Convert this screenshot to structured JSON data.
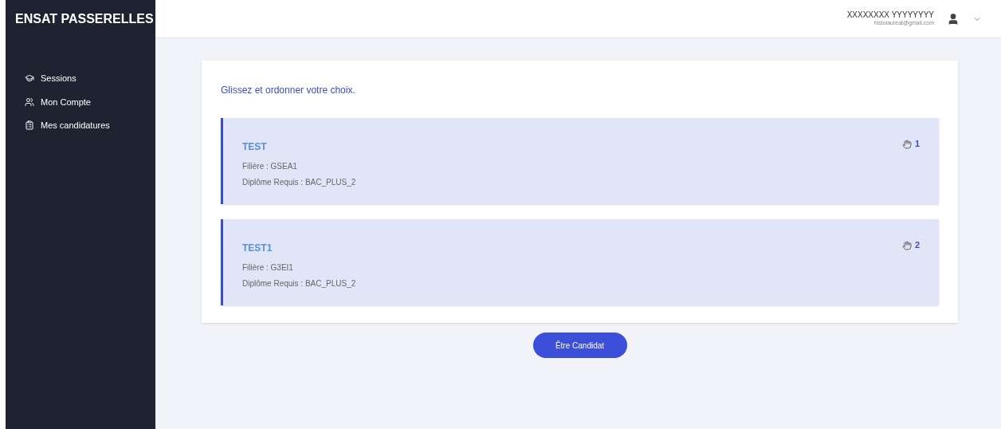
{
  "sidebar": {
    "brand": "ENSAT PASSERELLES",
    "items": [
      {
        "kind": "sessions",
        "label": "Sessions"
      },
      {
        "kind": "account",
        "label": "Mon Compte"
      },
      {
        "kind": "applications",
        "label": "Mes candidatures"
      }
    ]
  },
  "header": {
    "user_name": "XXXXXXXX YYYYYYYY",
    "user_email": "histolaureat@gmail.com"
  },
  "main": {
    "instruction": "Glissez et ordonner votre choix.",
    "choices": [
      {
        "title": "TEST",
        "filiere": "Filière : GSEA1",
        "diplome": "Diplôme Requis : BAC_PLUS_2",
        "rank": "1"
      },
      {
        "title": "TEST1",
        "filiere": "Filière : G3EI1",
        "diplome": "Diplôme Requis : BAC_PLUS_2",
        "rank": "2"
      }
    ],
    "submit_button": "Être Candidat"
  }
}
